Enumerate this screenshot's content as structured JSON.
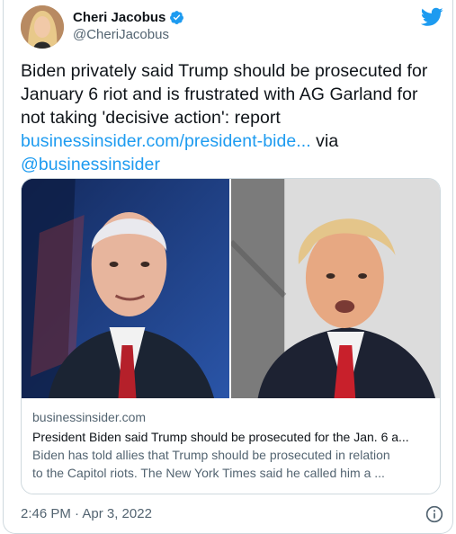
{
  "tweet": {
    "author": {
      "display_name": "Cheri Jacobus",
      "handle": "@CheriJacobus",
      "verified": true
    },
    "text_main": "Biden privately said Trump should be prosecuted for January 6 riot and is frustrated with AG Garland for not taking 'decisive action': report",
    "link_url": "businessinsider.com/president-bide...",
    "text_via": " via",
    "mention": "@businessinsider",
    "timestamp": "2:46 PM · Apr 3, 2022",
    "icons": {
      "platform": "twitter-bird-icon",
      "verified": "verified-badge-icon",
      "info": "info-icon"
    },
    "colors": {
      "link": "#1d9bf0",
      "text": "#0f1419",
      "secondary": "#536471"
    }
  },
  "link_card": {
    "domain": "businessinsider.com",
    "title": "President Biden said Trump should be prosecuted for the Jan. 6 a...",
    "description_line1": "Biden has told allies that Trump should be prosecuted in relation",
    "description_line2": "to the Capitol riots. The New York Times said he called him a ..."
  }
}
